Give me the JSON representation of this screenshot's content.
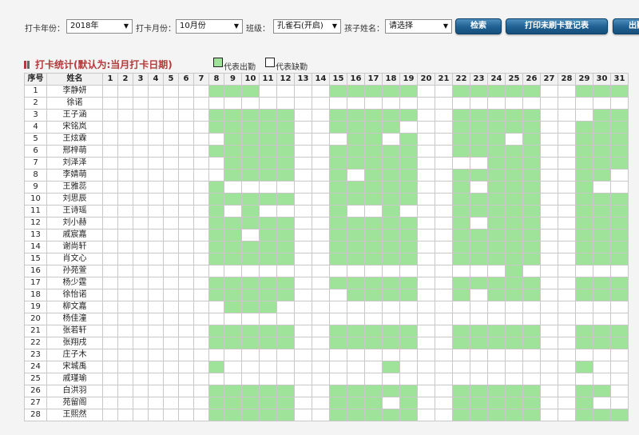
{
  "filters": {
    "year_label": "打卡年份：",
    "year_value": "2018年",
    "month_label": "打卡月份：",
    "month_value": "10月份",
    "class_label": "班级：",
    "class_value": "孔雀石(开启)",
    "child_label": "孩子姓名：",
    "child_value": "请选择"
  },
  "buttons": {
    "search": "检索",
    "print": "打印未刷卡登记表",
    "export": "出勤"
  },
  "section": {
    "title": "打卡统计(默认为:当月打卡日期)",
    "legend_present": "代表出勤",
    "legend_absent": "代表缺勤"
  },
  "colors": {
    "present": "#9fe39b",
    "absent": "#ffffff",
    "marker_red": "#b33a3a",
    "marker_gray": "#666666"
  },
  "table": {
    "headers": {
      "index": "序号",
      "name": "姓名"
    },
    "days": [
      "1",
      "2",
      "3",
      "4",
      "5",
      "6",
      "7",
      "8",
      "9",
      "10",
      "11",
      "12",
      "13",
      "14",
      "15",
      "16",
      "17",
      "18",
      "19",
      "20",
      "21",
      "22",
      "23",
      "24",
      "25",
      "26",
      "27",
      "28",
      "29",
      "30",
      "31"
    ],
    "rows": [
      {
        "index": "1",
        "name": "李静妍",
        "present": [
          8,
          9,
          10,
          15,
          16,
          17,
          18,
          19,
          22,
          23,
          24,
          25,
          26,
          29,
          30,
          31
        ]
      },
      {
        "index": "2",
        "name": "徐诺",
        "present": []
      },
      {
        "index": "3",
        "name": "王子涵",
        "present": [
          8,
          9,
          10,
          11,
          12,
          15,
          16,
          17,
          18,
          19,
          22,
          23,
          24,
          25,
          26,
          30,
          31
        ]
      },
      {
        "index": "4",
        "name": "宋铭岚",
        "present": [
          8,
          9,
          10,
          11,
          12,
          15,
          16,
          17,
          18,
          22,
          23,
          24,
          25,
          26,
          29,
          30,
          31
        ]
      },
      {
        "index": "5",
        "name": "王炫霖",
        "present": [
          9,
          10,
          11,
          12,
          16,
          17,
          19,
          22,
          23,
          24,
          26,
          29,
          30,
          31
        ]
      },
      {
        "index": "6",
        "name": "邢梓萌",
        "present": [
          8,
          9,
          10,
          11,
          12,
          15,
          16,
          17,
          18,
          19,
          22,
          23,
          24,
          25,
          26,
          29,
          30,
          31
        ]
      },
      {
        "index": "7",
        "name": "刘泽泽",
        "present": [
          9,
          10,
          11,
          12,
          15,
          16,
          17,
          18,
          19,
          24,
          25,
          26,
          29,
          30,
          31
        ]
      },
      {
        "index": "8",
        "name": "李婧萌",
        "present": [
          9,
          10,
          11,
          12,
          15,
          17,
          18,
          19,
          22,
          23,
          24,
          25,
          26,
          29,
          30
        ]
      },
      {
        "index": "9",
        "name": "王雅蕊",
        "present": [
          8,
          15,
          16,
          17,
          18,
          19,
          22,
          24,
          25,
          26,
          29
        ]
      },
      {
        "index": "10",
        "name": "刘思辰",
        "present": [
          8,
          9,
          10,
          11,
          12,
          15,
          16,
          17,
          18,
          19,
          22,
          23,
          24,
          25,
          26,
          29,
          30,
          31
        ]
      },
      {
        "index": "11",
        "name": "王诗瑶",
        "present": [
          8,
          10,
          15,
          18,
          22,
          23,
          24,
          25,
          26,
          29,
          30,
          31
        ]
      },
      {
        "index": "12",
        "name": "刘小赫",
        "present": [
          8,
          9,
          10,
          11,
          12,
          15,
          16,
          17,
          18,
          19,
          22,
          24,
          25,
          26,
          29,
          30,
          31
        ]
      },
      {
        "index": "13",
        "name": "戚宸嘉",
        "present": [
          8,
          9,
          11,
          12,
          15,
          16,
          17,
          18,
          19,
          22,
          23,
          24,
          25,
          26,
          29,
          30,
          31
        ]
      },
      {
        "index": "14",
        "name": "谢尚轩",
        "present": [
          8,
          9,
          10,
          11,
          12,
          15,
          16,
          17,
          18,
          19,
          22,
          23,
          24,
          25,
          26,
          29,
          30,
          31
        ]
      },
      {
        "index": "15",
        "name": "肖文心",
        "present": [
          8,
          9,
          10,
          11,
          12,
          15,
          16,
          17,
          18,
          19,
          22,
          23,
          24,
          25,
          26,
          29,
          30,
          31
        ]
      },
      {
        "index": "16",
        "name": "孙苑萱",
        "present": [
          25
        ]
      },
      {
        "index": "17",
        "name": "杨少霆",
        "present": [
          8,
          9,
          10,
          11,
          12,
          15,
          16,
          17,
          18,
          19,
          22,
          23,
          24,
          25,
          26,
          29,
          30,
          31
        ]
      },
      {
        "index": "18",
        "name": "徐怡诺",
        "present": [
          8,
          9,
          10,
          11,
          12,
          16,
          17,
          18,
          19,
          22,
          24,
          25,
          26,
          29,
          30,
          31
        ]
      },
      {
        "index": "19",
        "name": "柳文嘉",
        "present": [
          9,
          10,
          11
        ]
      },
      {
        "index": "20",
        "name": "杨佳潼",
        "present": []
      },
      {
        "index": "21",
        "name": "张若轩",
        "present": [
          8,
          9,
          10,
          11,
          12,
          15,
          16,
          17,
          18,
          19,
          22,
          23,
          24,
          25,
          26,
          29,
          30,
          31
        ]
      },
      {
        "index": "22",
        "name": "张翔戌",
        "present": [
          8,
          9,
          10,
          11,
          12,
          15,
          16,
          17,
          18,
          19,
          22,
          23,
          24,
          25,
          26,
          29,
          30,
          31
        ]
      },
      {
        "index": "23",
        "name": "庄子木",
        "present": []
      },
      {
        "index": "24",
        "name": "宋城禹",
        "present": [
          8,
          18,
          29
        ]
      },
      {
        "index": "25",
        "name": "戚瑾瑜",
        "present": []
      },
      {
        "index": "26",
        "name": "白洪羽",
        "present": [
          8,
          9,
          10,
          11,
          12,
          15,
          16,
          17,
          18,
          19,
          22,
          23,
          24,
          25,
          26,
          29,
          30
        ]
      },
      {
        "index": "27",
        "name": "苑留阁",
        "present": [
          8,
          9,
          10,
          11,
          12,
          15,
          16,
          17,
          19,
          22,
          23,
          24,
          25,
          26,
          29
        ]
      },
      {
        "index": "28",
        "name": "王熙然",
        "present": [
          8,
          9,
          10,
          11,
          12,
          15,
          16,
          17,
          18,
          19,
          22,
          23,
          24,
          25,
          26,
          29,
          30,
          31
        ]
      }
    ]
  }
}
